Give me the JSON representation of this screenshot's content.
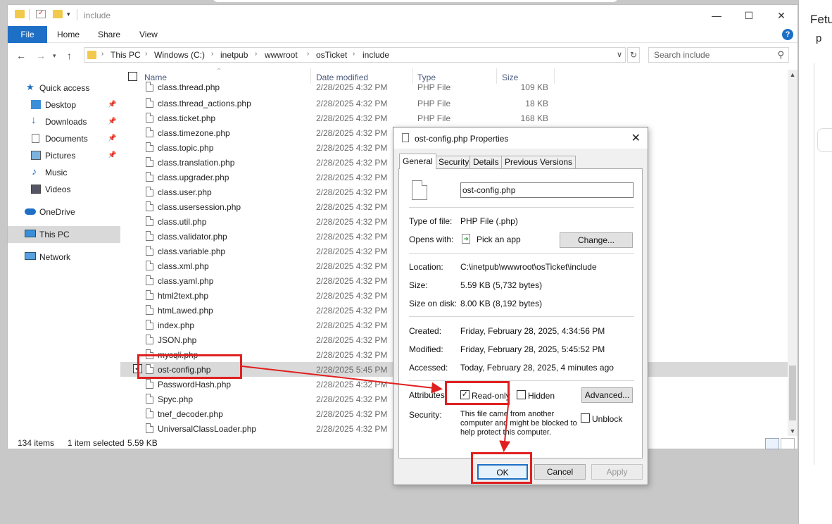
{
  "window": {
    "title": "include",
    "minimize": "—",
    "maximize": "☐",
    "close": "✕"
  },
  "ribbon": {
    "file": "File",
    "home": "Home",
    "share": "Share",
    "view": "View",
    "help": "?"
  },
  "address": {
    "crumbs": [
      "This PC",
      "Windows (C:)",
      "inetpub",
      "wwwroot",
      "osTicket",
      "include"
    ],
    "search_placeholder": "Search include"
  },
  "nav": {
    "quick_access": "Quick access",
    "desktop": "Desktop",
    "downloads": "Downloads",
    "documents": "Documents",
    "pictures": "Pictures",
    "music": "Music",
    "videos": "Videos",
    "onedrive": "OneDrive",
    "this_pc": "This PC",
    "network": "Network"
  },
  "columns": {
    "name": "Name",
    "date": "Date modified",
    "type": "Type",
    "size": "Size"
  },
  "files": [
    {
      "name": "class.thread.php",
      "date": "2/28/2025 4:32 PM",
      "type": "PHP File",
      "size": "109 KB"
    },
    {
      "name": "class.thread_actions.php",
      "date": "2/28/2025 4:32 PM",
      "type": "PHP File",
      "size": "18 KB"
    },
    {
      "name": "class.ticket.php",
      "date": "2/28/2025 4:32 PM",
      "type": "PHP File",
      "size": "168 KB"
    },
    {
      "name": "class.timezone.php",
      "date": "2/28/2025 4:32 PM",
      "type": "",
      "size": ""
    },
    {
      "name": "class.topic.php",
      "date": "2/28/2025 4:32 PM",
      "type": "",
      "size": ""
    },
    {
      "name": "class.translation.php",
      "date": "2/28/2025 4:32 PM",
      "type": "",
      "size": ""
    },
    {
      "name": "class.upgrader.php",
      "date": "2/28/2025 4:32 PM",
      "type": "",
      "size": ""
    },
    {
      "name": "class.user.php",
      "date": "2/28/2025 4:32 PM",
      "type": "",
      "size": ""
    },
    {
      "name": "class.usersession.php",
      "date": "2/28/2025 4:32 PM",
      "type": "",
      "size": ""
    },
    {
      "name": "class.util.php",
      "date": "2/28/2025 4:32 PM",
      "type": "",
      "size": ""
    },
    {
      "name": "class.validator.php",
      "date": "2/28/2025 4:32 PM",
      "type": "",
      "size": ""
    },
    {
      "name": "class.variable.php",
      "date": "2/28/2025 4:32 PM",
      "type": "",
      "size": ""
    },
    {
      "name": "class.xml.php",
      "date": "2/28/2025 4:32 PM",
      "type": "",
      "size": ""
    },
    {
      "name": "class.yaml.php",
      "date": "2/28/2025 4:32 PM",
      "type": "",
      "size": ""
    },
    {
      "name": "html2text.php",
      "date": "2/28/2025 4:32 PM",
      "type": "",
      "size": ""
    },
    {
      "name": "htmLawed.php",
      "date": "2/28/2025 4:32 PM",
      "type": "",
      "size": ""
    },
    {
      "name": "index.php",
      "date": "2/28/2025 4:32 PM",
      "type": "",
      "size": ""
    },
    {
      "name": "JSON.php",
      "date": "2/28/2025 4:32 PM",
      "type": "",
      "size": ""
    },
    {
      "name": "mysqli.php",
      "date": "2/28/2025 4:32 PM",
      "type": "",
      "size": ""
    },
    {
      "name": "ost-config.php",
      "date": "2/28/2025 5:45 PM",
      "type": "",
      "size": "",
      "selected": true
    },
    {
      "name": "PasswordHash.php",
      "date": "2/28/2025 4:32 PM",
      "type": "",
      "size": ""
    },
    {
      "name": "Spyc.php",
      "date": "2/28/2025 4:32 PM",
      "type": "",
      "size": ""
    },
    {
      "name": "tnef_decoder.php",
      "date": "2/28/2025 4:32 PM",
      "type": "",
      "size": ""
    },
    {
      "name": "UniversalClassLoader.php",
      "date": "2/28/2025 4:32 PM",
      "type": "",
      "size": ""
    }
  ],
  "status": {
    "items": "134 items",
    "selected": "1 item selected",
    "size": "5.59 KB"
  },
  "dialog": {
    "title": "ost-config.php Properties",
    "tabs": [
      "General",
      "Security",
      "Details",
      "Previous Versions"
    ],
    "filename": "ost-config.php",
    "type_label": "Type of file:",
    "type_value": "PHP File (.php)",
    "opens_label": "Opens with:",
    "opens_value": "Pick an app",
    "change": "Change...",
    "location_label": "Location:",
    "location_value": "C:\\inetpub\\wwwroot\\osTicket\\include",
    "size_label": "Size:",
    "size_value": "5.59 KB (5,732 bytes)",
    "disk_label": "Size on disk:",
    "disk_value": "8.00 KB (8,192 bytes)",
    "created_label": "Created:",
    "created_value": "Friday, February 28, 2025, 4:34:56 PM",
    "modified_label": "Modified:",
    "modified_value": "Friday, February 28, 2025, 5:45:52 PM",
    "accessed_label": "Accessed:",
    "accessed_value": "Today, February 28, 2025, 4 minutes ago",
    "attributes_label": "Attributes:",
    "readonly": "Read-only",
    "hidden": "Hidden",
    "advanced": "Advanced...",
    "security_label": "Security:",
    "security_text": "This file came from another computer and might be blocked to help protect this computer.",
    "unblock": "Unblock",
    "ok": "OK",
    "cancel": "Cancel",
    "apply": "Apply"
  },
  "background_window": {
    "fragment1": "Fetu",
    "fragment2": "p"
  },
  "colors": {
    "accent": "#1e6fc6",
    "annotation": "#e02020",
    "selection": "#d9d9d9"
  }
}
